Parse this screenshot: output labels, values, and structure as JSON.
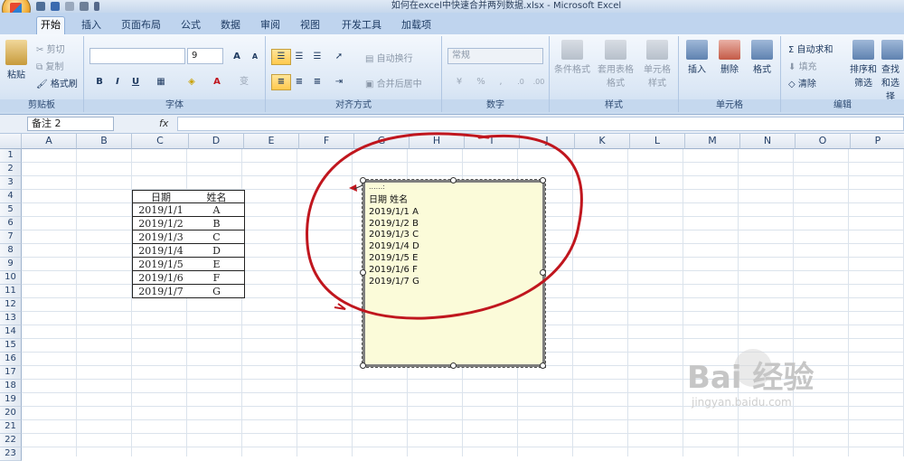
{
  "window": {
    "title": "如何在excel中快速合并两列数据.xlsx - Microsoft Excel"
  },
  "tabs": [
    "开始",
    "插入",
    "页面布局",
    "公式",
    "数据",
    "审阅",
    "视图",
    "开发工具",
    "加载项"
  ],
  "ribbon": {
    "clipboard": {
      "label": "剪贴板",
      "paste": "粘贴",
      "cut": "剪切",
      "copy": "复制",
      "format_painter": "格式刷"
    },
    "font": {
      "label": "字体",
      "size": "9",
      "grow": "A",
      "shrink": "A",
      "bold": "B",
      "italic": "I",
      "underline": "U",
      "font_color": "A",
      "phonetic": "变"
    },
    "alignment": {
      "label": "对齐方式",
      "wrap": "自动换行",
      "merge": "合并后居中"
    },
    "number": {
      "label": "数字",
      "format": "常规",
      "percent": "%",
      "comma": ","
    },
    "styles": {
      "label": "样式",
      "conditional": "条件格式",
      "table": "套用表格格式",
      "cell_styles": "单元格样式"
    },
    "cells": {
      "label": "单元格",
      "insert": "插入",
      "delete": "删除",
      "format": "格式"
    },
    "editing": {
      "label": "编辑",
      "autosum": "自动求和",
      "fill": "填充",
      "clear": "清除",
      "sort": "排序和筛选",
      "find": "查找和选择"
    }
  },
  "formula_bar": {
    "name_box": "备注 2",
    "fx": "fx",
    "content": ""
  },
  "columns": [
    "A",
    "B",
    "C",
    "D",
    "E",
    "F",
    "G",
    "H",
    "I",
    "J",
    "K",
    "L",
    "M",
    "N",
    "O",
    "P"
  ],
  "rows": [
    "1",
    "2",
    "3",
    "4",
    "5",
    "6",
    "7",
    "8",
    "9",
    "10",
    "11",
    "12",
    "13",
    "14",
    "15",
    "16",
    "17",
    "18",
    "19",
    "20",
    "21",
    "22",
    "23"
  ],
  "table": {
    "headers": [
      "日期",
      "姓名"
    ],
    "rows": [
      [
        "2019/1/1",
        "A"
      ],
      [
        "2019/1/2",
        "B"
      ],
      [
        "2019/1/3",
        "C"
      ],
      [
        "2019/1/4",
        "D"
      ],
      [
        "2019/1/5",
        "E"
      ],
      [
        "2019/1/6",
        "F"
      ],
      [
        "2019/1/7",
        "G"
      ]
    ]
  },
  "comment": {
    "author": "......:",
    "text": "日期 姓名\n2019/1/1 A\n2019/1/2 B\n2019/1/3 C\n2019/1/4 D\n2019/1/5 E\n2019/1/6 F\n2019/1/7 G"
  },
  "annotation": {
    "color": "#c0161e"
  },
  "watermark": {
    "brand": "Bai 经验",
    "url": "jingyan.baidu.com"
  }
}
